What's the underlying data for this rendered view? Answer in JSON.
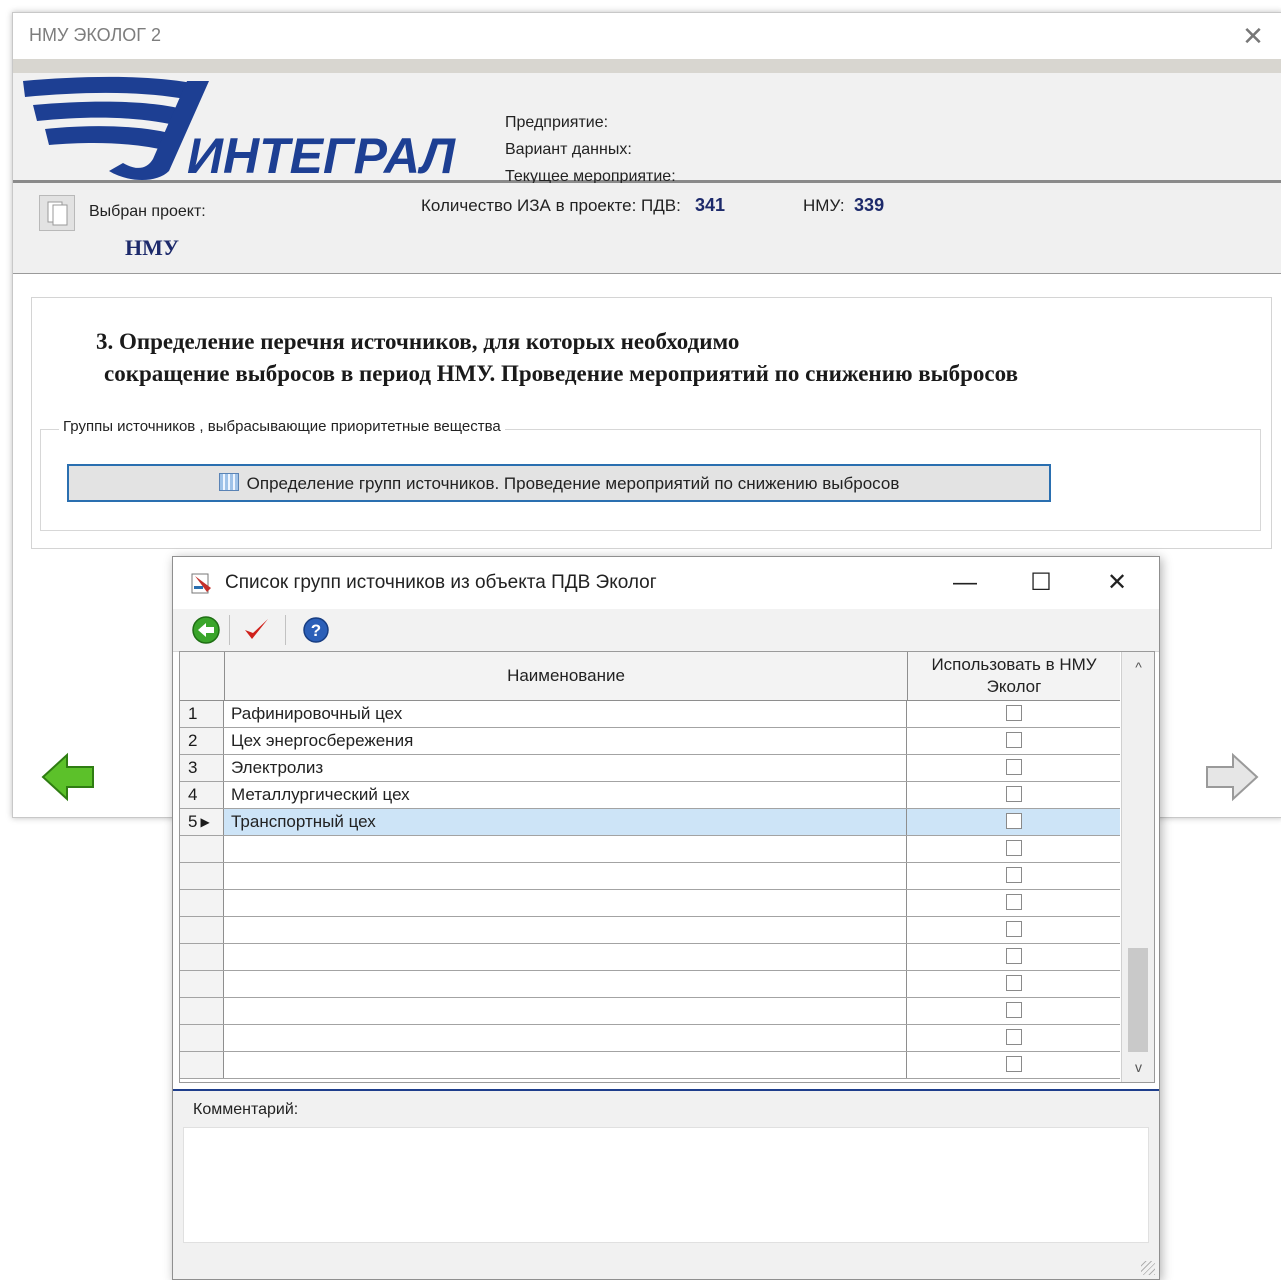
{
  "main_window": {
    "title": "НМУ ЭКОЛОГ 2",
    "logo_text": "ИНТЕГРАЛ",
    "info": {
      "enterprise_label": "Предприятие:",
      "data_variant_label": "Вариант данных:",
      "current_event_label": "Текущее мероприятие:"
    },
    "project": {
      "selected_label": "Выбран проект:",
      "name": "НМУ",
      "iza_label": "Количество ИЗА в проекте: ПДВ:",
      "pdv_count": "341",
      "nmu_label": "НМУ:",
      "nmu_count": "339"
    },
    "step": {
      "title_line1": "3.  Определение перечня источников, для которых необходимо",
      "title_line2": "сокращение выбросов в период НМУ. Проведение мероприятий по снижению выбросов",
      "group_legend": "Группы источников , выбрасывающие приоритетные вещества",
      "button_label": "Определение групп источников. Проведение мероприятий по снижению выбросов"
    },
    "colors": {
      "accent": "#2a6fb0",
      "brand": "#1d2a6b",
      "nav_back": "#4caf1f"
    }
  },
  "dialog": {
    "title": "Список групп источников из объекта ПДВ Эколог",
    "toolbar": {
      "back_icon": "green-back-arrow-icon",
      "check_icon": "red-checkmark-icon",
      "help_icon": "help-icon"
    },
    "columns": {
      "name": "Наименование",
      "use": "Использовать в НМУ Эколог"
    },
    "rows": [
      {
        "num": "1",
        "name": "Рафинировочный цех",
        "use": false
      },
      {
        "num": "2",
        "name": "Цех энергосбережения",
        "use": false
      },
      {
        "num": "3",
        "name": "Электролиз",
        "use": false
      },
      {
        "num": "4",
        "name": "Металлургический цех",
        "use": false
      },
      {
        "num": "5",
        "name": "Транспортный цех",
        "use": false,
        "selected": true
      }
    ],
    "empty_rows": 9,
    "comment_label": "Комментарий:",
    "scroll_up": "^",
    "scroll_down": "v"
  }
}
